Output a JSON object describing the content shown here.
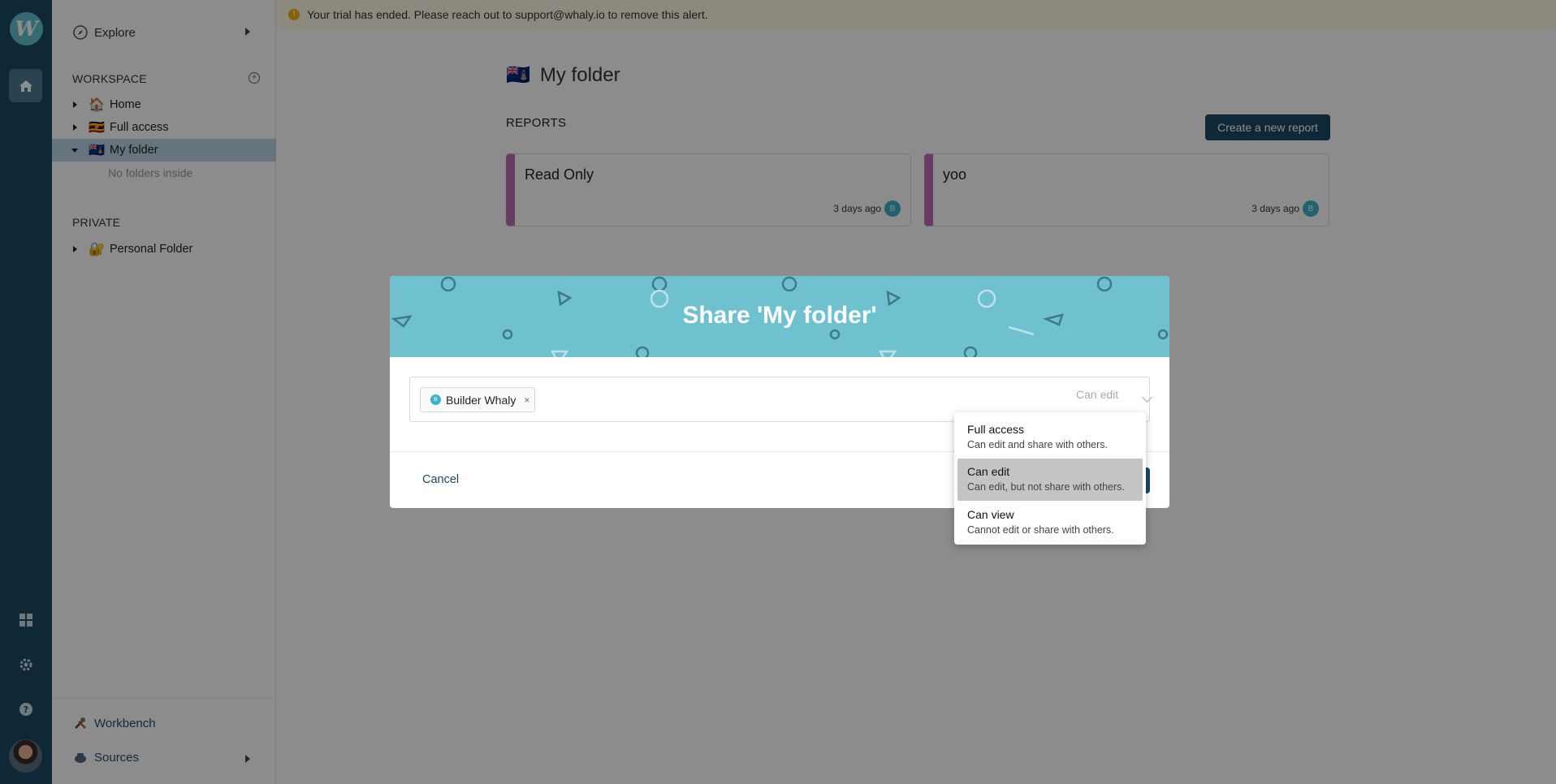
{
  "sidebar": {
    "explore_label": "Explore",
    "workspace_heading": "WORKSPACE",
    "items": [
      {
        "emoji": "🏠",
        "label": "Home"
      },
      {
        "emoji": "🇺🇬",
        "label": "Full access"
      },
      {
        "emoji": "🇰🇾",
        "label": "My folder"
      }
    ],
    "empty_text": "No folders inside",
    "private_heading": "PRIVATE",
    "private_items": [
      {
        "emoji": "🔐",
        "label": "Personal Folder"
      }
    ],
    "workbench_label": "Workbench",
    "sources_label": "Sources"
  },
  "alert": {
    "text": "Your trial has ended. Please reach out to support@whaly.io to remove this alert."
  },
  "folder": {
    "emoji": "🇰🇾",
    "title": "My folder",
    "reports_heading": "REPORTS",
    "create_button": "Create a new report",
    "reports": [
      {
        "title": "Read Only",
        "date": "3 days ago",
        "avatar": "B"
      },
      {
        "title": "yoo",
        "date": "3 days ago",
        "avatar": "B"
      }
    ]
  },
  "modal": {
    "title": "Share 'My folder'",
    "tag_name": "Builder Whaly",
    "tag_avatar": "B",
    "tag_remove": "×",
    "selected_permission": "Can edit",
    "cancel_label": "Cancel"
  },
  "dropdown": {
    "options": [
      {
        "label": "Full access",
        "desc": "Can edit and share with others."
      },
      {
        "label": "Can edit",
        "desc": "Can edit, but not share with others."
      },
      {
        "label": "Can view",
        "desc": "Cannot edit or share with others."
      }
    ],
    "selected_index": 1
  },
  "colors": {
    "rail": "#1a4965",
    "accent": "#1a4965",
    "modal_header": "#6fc1d0",
    "card_stripe": "#c36db5",
    "selected_row": "#b8d3e4"
  }
}
